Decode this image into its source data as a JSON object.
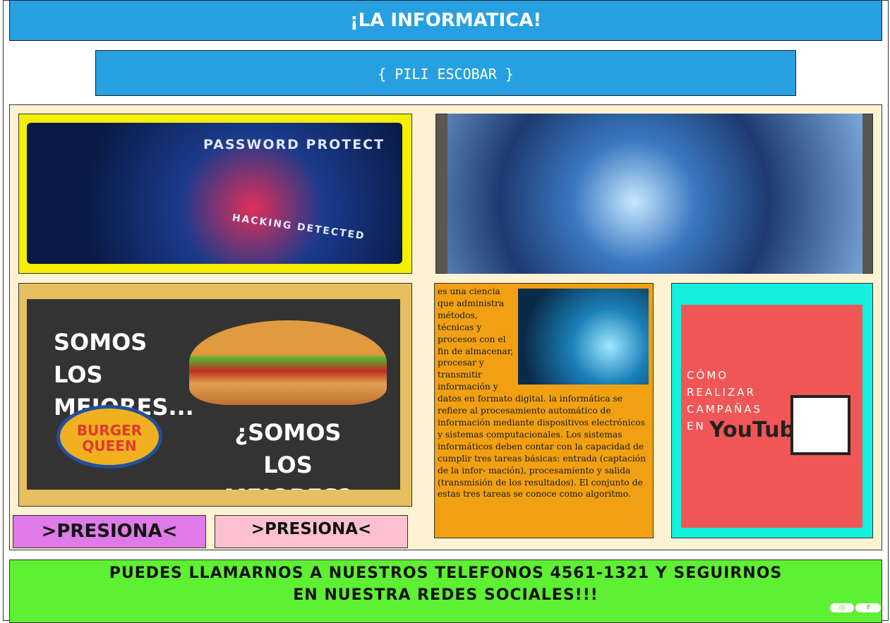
{
  "header": {
    "title": "¡LA INFORMATICA!"
  },
  "subheader": {
    "author": "{ PILI ESCOBAR }"
  },
  "images": {
    "security": {
      "text_top": "PASSWORD PROTECT",
      "text_bottom": "HACKING DETECTED"
    },
    "burger_ad": {
      "line1": "SOMOS LOS MEJORES...",
      "line2": "¿SOMOS LOS MEJORES?",
      "logo": "BURGER QUEEN"
    },
    "youtube_ad": {
      "text": "CÓMO REALIZAR CAMPAÑAS EN",
      "logo": "YouTube"
    }
  },
  "buttons": {
    "press1": ">PRESIONA<",
    "press2": ">PRESIONA<"
  },
  "article": {
    "text": "es una ciencia que administra métodos, técnicas y procesos con el fin de almacenar, procesar y transmitir información y datos en formato digital. la informática se refiere al procesamiento automático de información mediante dispositivos electrónicos y sistemas computacionales. Los sistemas informáticos deben contar con la capacidad de cumplir tres tareas básicas: entrada (captación de la infor- mación), procesamiento y salida (transmisión de los resultados). El conjunto de estas tres tareas se conoce como algoritmo."
  },
  "footer": {
    "text": "PUEDES LLAMARNOS A NUESTROS TELEFONOS 4561-1321 Y SEGUIRNOS EN NUESTRA REDES SOCIALES!!!",
    "icons": [
      "instagram-icon",
      "facebook-icon"
    ]
  },
  "colors": {
    "header": "#27a0e2",
    "panel": "#fdf3d3",
    "footer": "#5ef032",
    "button1": "#e07ae8",
    "button2": "#fcc0d0"
  }
}
